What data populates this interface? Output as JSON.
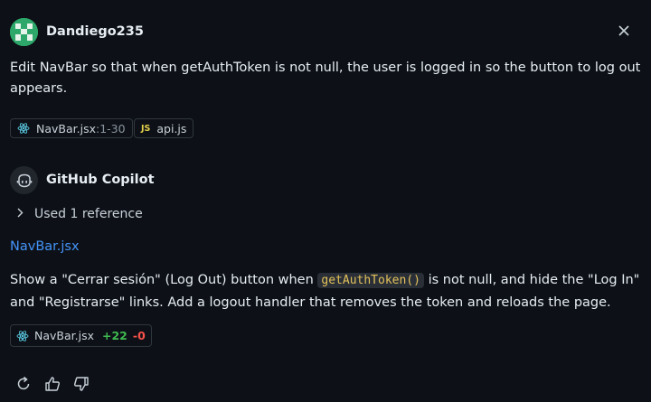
{
  "user": {
    "name": "Dandiego235",
    "avatar_color": "#2ea86a"
  },
  "user_message": "Edit NavBar so that when getAuthToken is not null, the user is logged in so the button to log out appears.",
  "attachments": [
    {
      "icon": "react-icon",
      "name": "NavBar.jsx",
      "range": ":1-30"
    },
    {
      "icon": "js-icon",
      "badge": "JS",
      "name": "api.js"
    }
  ],
  "assistant": {
    "name": "GitHub Copilot",
    "references_label": "Used 1 reference",
    "file_link": "NavBar.jsx",
    "response": {
      "before_code": "Show a \"Cerrar sesión\" (Log Out) button when ",
      "code": "getAuthToken()",
      "after_code": " is not null, and hide the \"Log In\" and \"Registrarse\" links. Add a logout handler that removes the token and reloads the page."
    },
    "edit": {
      "file": "NavBar.jsx",
      "added": "+22",
      "removed": "-0"
    }
  },
  "actions": [
    "retry-icon",
    "thumbs-up-icon",
    "thumbs-down-icon"
  ],
  "colors": {
    "background": "#0d1117",
    "link": "#4493f8",
    "added": "#3fb950",
    "removed": "#f85149",
    "code": "#e3c15a"
  }
}
